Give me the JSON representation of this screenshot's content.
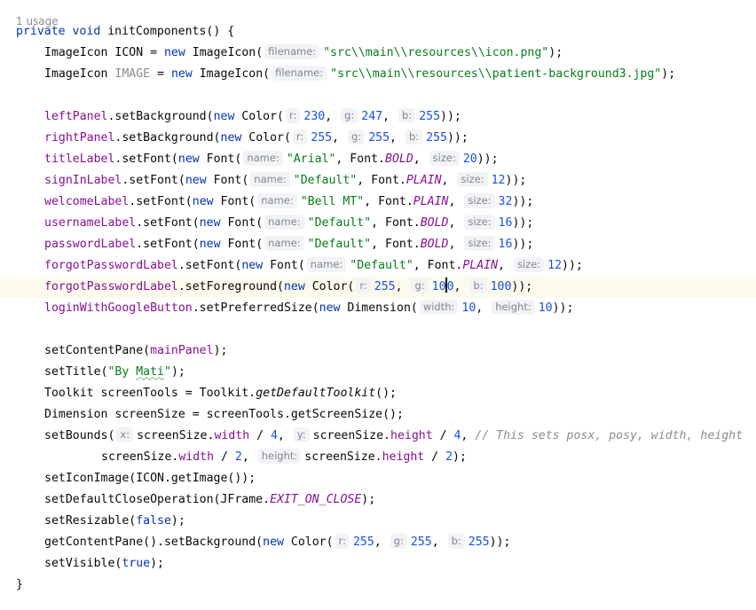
{
  "usage_label": "1 usage",
  "code_lines": [
    [
      "private void initComponents() {"
    ],
    [
      "ImageIcon ICON = new ImageIcon(",
      "filename:",
      "\"src\\\\main\\\\resources\\\\icon.png\"",
      ");"
    ],
    [
      "ImageIcon IMAGE = new ImageIcon(",
      "filename:",
      "\"src\\\\main\\\\resources\\\\patient-background3.jpg\"",
      ");"
    ],
    [
      "leftPanel.setBackground(new Color(",
      "r:",
      "230, ",
      "g:",
      "247, ",
      "b:",
      "255));"
    ],
    [
      "rightPanel.setBackground(new Color(",
      "r:",
      "255, ",
      "g:",
      "255, ",
      "b:",
      "255));"
    ],
    [
      "titleLabel.setFont(new Font(",
      "name:",
      "\"Arial\", Font.BOLD, ",
      "size:",
      "20));"
    ],
    [
      "signInLabel.setFont(new Font(",
      "name:",
      "\"Default\", Font.PLAIN, ",
      "size:",
      "12));"
    ],
    [
      "welcomeLabel.setFont(new Font(",
      "name:",
      "\"Bell MT\", Font.PLAIN, ",
      "size:",
      "32));"
    ],
    [
      "usernameLabel.setFont(new Font(",
      "name:",
      "\"Default\", Font.BOLD, ",
      "size:",
      "16));"
    ],
    [
      "passwordLabel.setFont(new Font(",
      "name:",
      "\"Default\", Font.BOLD, ",
      "size:",
      "16));"
    ],
    [
      "forgotPasswordLabel.setFont(new Font(",
      "name:",
      "\"Default\", Font.PLAIN, ",
      "size:",
      "12));"
    ],
    [
      "forgotPasswordLabel.setForeground(new Color(",
      "r:",
      "255, ",
      "g:",
      "100, ",
      "b:",
      "100));"
    ],
    [
      "loginWithGoogleButton.setPreferredSize(new Dimension(",
      "width:",
      "10, ",
      "height:",
      "10));"
    ],
    [
      "setContentPane(mainPanel);"
    ],
    [
      "setTitle(\"By Mati\");"
    ],
    [
      "Toolkit screenTools = Toolkit.getDefaultToolkit();"
    ],
    [
      "Dimension screenSize = screenTools.getScreenSize();"
    ],
    [
      "setBounds(",
      "x:",
      "screenSize.width / 4, ",
      "y:",
      "screenSize.height / 4, // This sets posx, posy, width, height"
    ],
    [
      "screenSize.width / 2, ",
      "height:",
      "screenSize.height / 2);"
    ],
    [
      "setIconImage(ICON.getImage());"
    ],
    [
      "setDefaultCloseOperation(JFrame.EXIT_ON_CLOSE);"
    ],
    [
      "setResizable(false);"
    ],
    [
      "getContentPane().setBackground(new Color(",
      "r:",
      "255, ",
      "g:",
      "255, ",
      "b:",
      "255));"
    ],
    [
      "setVisible(true);"
    ],
    [
      "}"
    ]
  ],
  "colors": {
    "keyword": "#0033b3",
    "field": "#871094",
    "string": "#067d17",
    "number": "#1750eb",
    "comment": "#8c8c8c",
    "hint_bg": "#f2f3f5",
    "current_line": "#fcfaed"
  }
}
